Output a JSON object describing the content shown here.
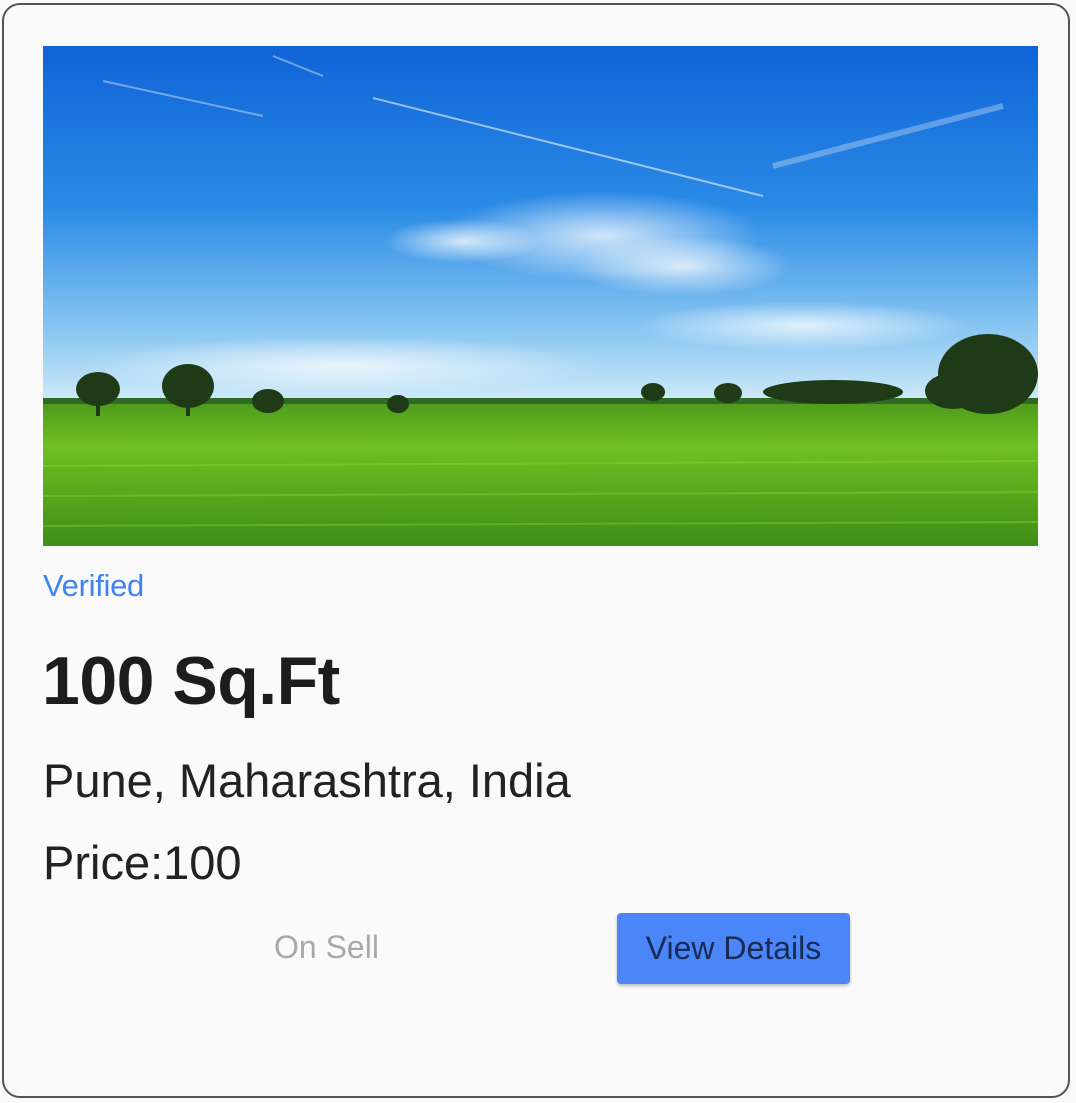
{
  "listing": {
    "image_icon": "field-landscape-image",
    "badge": "Verified",
    "area": "100 Sq.Ft",
    "location": "Pune, Maharashtra, India",
    "price": "Price:100",
    "status": "On Sell",
    "view_button_label": "View Details"
  },
  "colors": {
    "accent": "#4a86f7",
    "badge_text": "#3f83f5",
    "status_text": "#a9a9a9"
  }
}
